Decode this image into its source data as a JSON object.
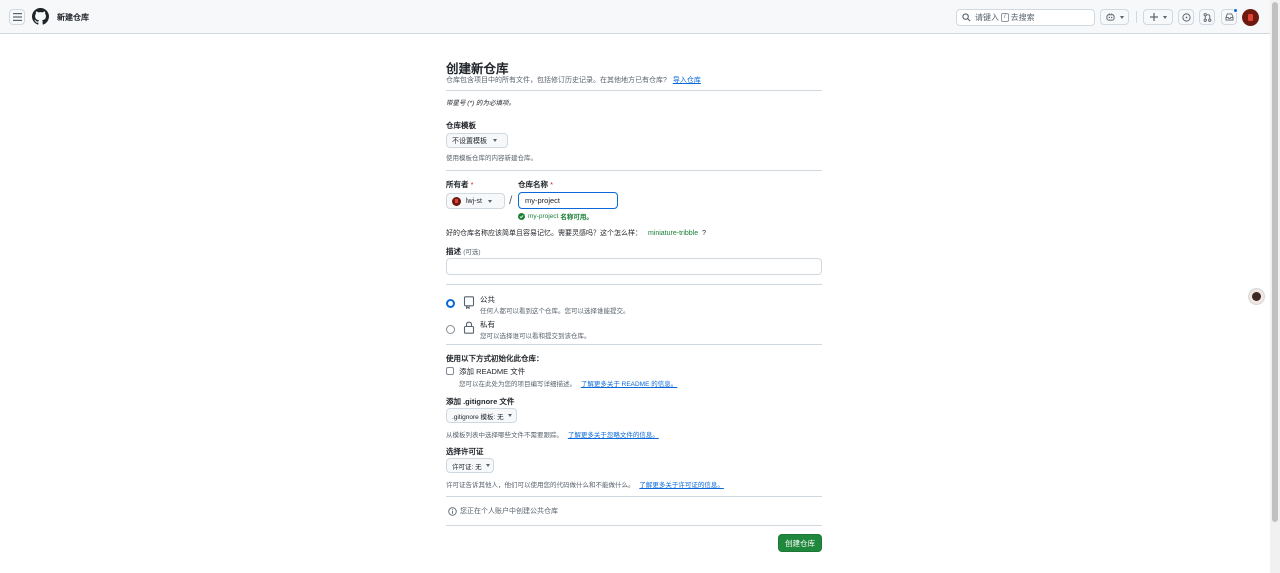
{
  "header": {
    "title": "新建仓库",
    "search_prefix": "请键入",
    "search_key": "/",
    "search_suffix": "去搜索"
  },
  "form": {
    "heading": "创建新仓库",
    "subtitle": "仓库包含项目中的所有文件，包括修订历史记录。在其他地方已有仓库?",
    "import_link": "导入仓库",
    "required_note": "带星号 (*) 的为必填项。",
    "template_label": "仓库模板",
    "template_value": "不设置模板",
    "template_note": "使用模板仓库的内容新建仓库。",
    "owner_label": "所有者",
    "owner_value": "lwj-st",
    "name_label": "仓库名称",
    "required_star": "*",
    "slash": "/",
    "name_value": "my-project",
    "name_available": "my-project",
    "name_available_suffix": "名称可用。",
    "suggestion_text": "好的仓库名称应该简单且容易记忆。需要灵感吗？这个怎么样：",
    "suggestion_name": "miniature-tribble",
    "suggestion_q": "?",
    "description_label": "描述",
    "description_optional": "(可选)",
    "description_value": "",
    "visibility": {
      "public_title": "公共",
      "public_desc": "任何人都可以看到这个仓库。您可以选择谁能提交。",
      "private_title": "私有",
      "private_desc": "您可以选择谁可以看和提交到该仓库。"
    },
    "init_label": "使用以下方式初始化此仓库：",
    "readme_label": "添加 README 文件",
    "readme_note": "您可以在此处为您的项目编写详细描述。",
    "readme_link": "了解更多关于 README 的信息。",
    "gitignore_label": "添加 .gitignore 文件",
    "gitignore_value": ".gitignore 模板: 无",
    "gitignore_note": "从模板列表中选择哪些文件不需要跟踪。",
    "gitignore_link": "了解更多关于忽略文件的信息。",
    "license_label": "选择许可证",
    "license_value": "许可证: 无",
    "license_note": "许可证告诉其他人，他们可以使用您的代码做什么和不能做什么。",
    "license_link": "了解更多关于许可证的信息。",
    "info_text": "您正在个人账户中创建公共仓库",
    "create_button": "创建仓库"
  },
  "state": {
    "visibility_selected": "public",
    "readme_checked": false
  },
  "colors": {
    "primary": "#1f883d",
    "link": "#0969da",
    "success": "#1a7f37"
  }
}
